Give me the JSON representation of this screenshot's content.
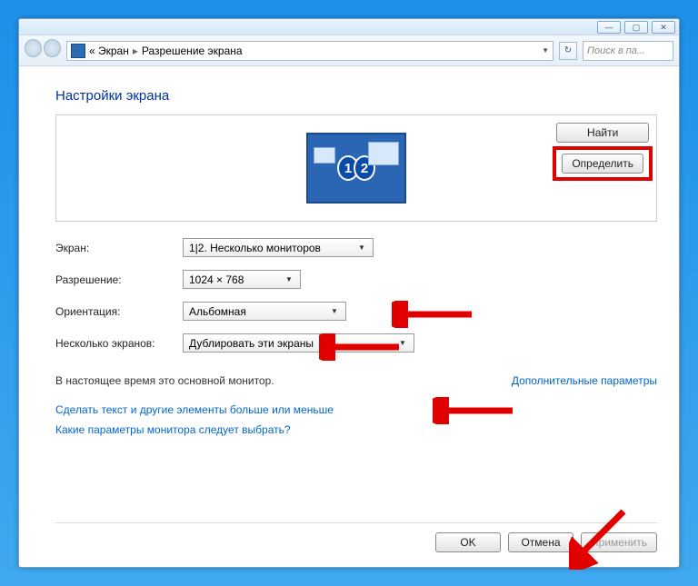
{
  "titlebar": {
    "min": "—",
    "max": "▢",
    "close": "✕"
  },
  "address": {
    "part1": "« Экран",
    "part2": "Разрешение экрана",
    "search_placeholder": "Поиск в па..."
  },
  "page": {
    "heading": "Настройки экрана",
    "find_btn": "Найти",
    "identify_btn": "Определить"
  },
  "labels": {
    "screen": "Экран:",
    "resolution": "Разрешение:",
    "orientation": "Ориентация:",
    "multi": "Несколько экранов:"
  },
  "values": {
    "screen": "1|2. Несколько мониторов",
    "resolution": "1024 × 768",
    "orientation": "Альбомная",
    "multi": "Дублировать эти экраны"
  },
  "info": {
    "main_monitor": "В настоящее время это основной монитор.",
    "adv_link": "Дополнительные параметры"
  },
  "links": {
    "l1": "Сделать текст и другие элементы больше или меньше",
    "l2": "Какие параметры монитора следует выбрать?"
  },
  "footer": {
    "ok": "OK",
    "cancel": "Отмена",
    "apply": "Применить"
  }
}
